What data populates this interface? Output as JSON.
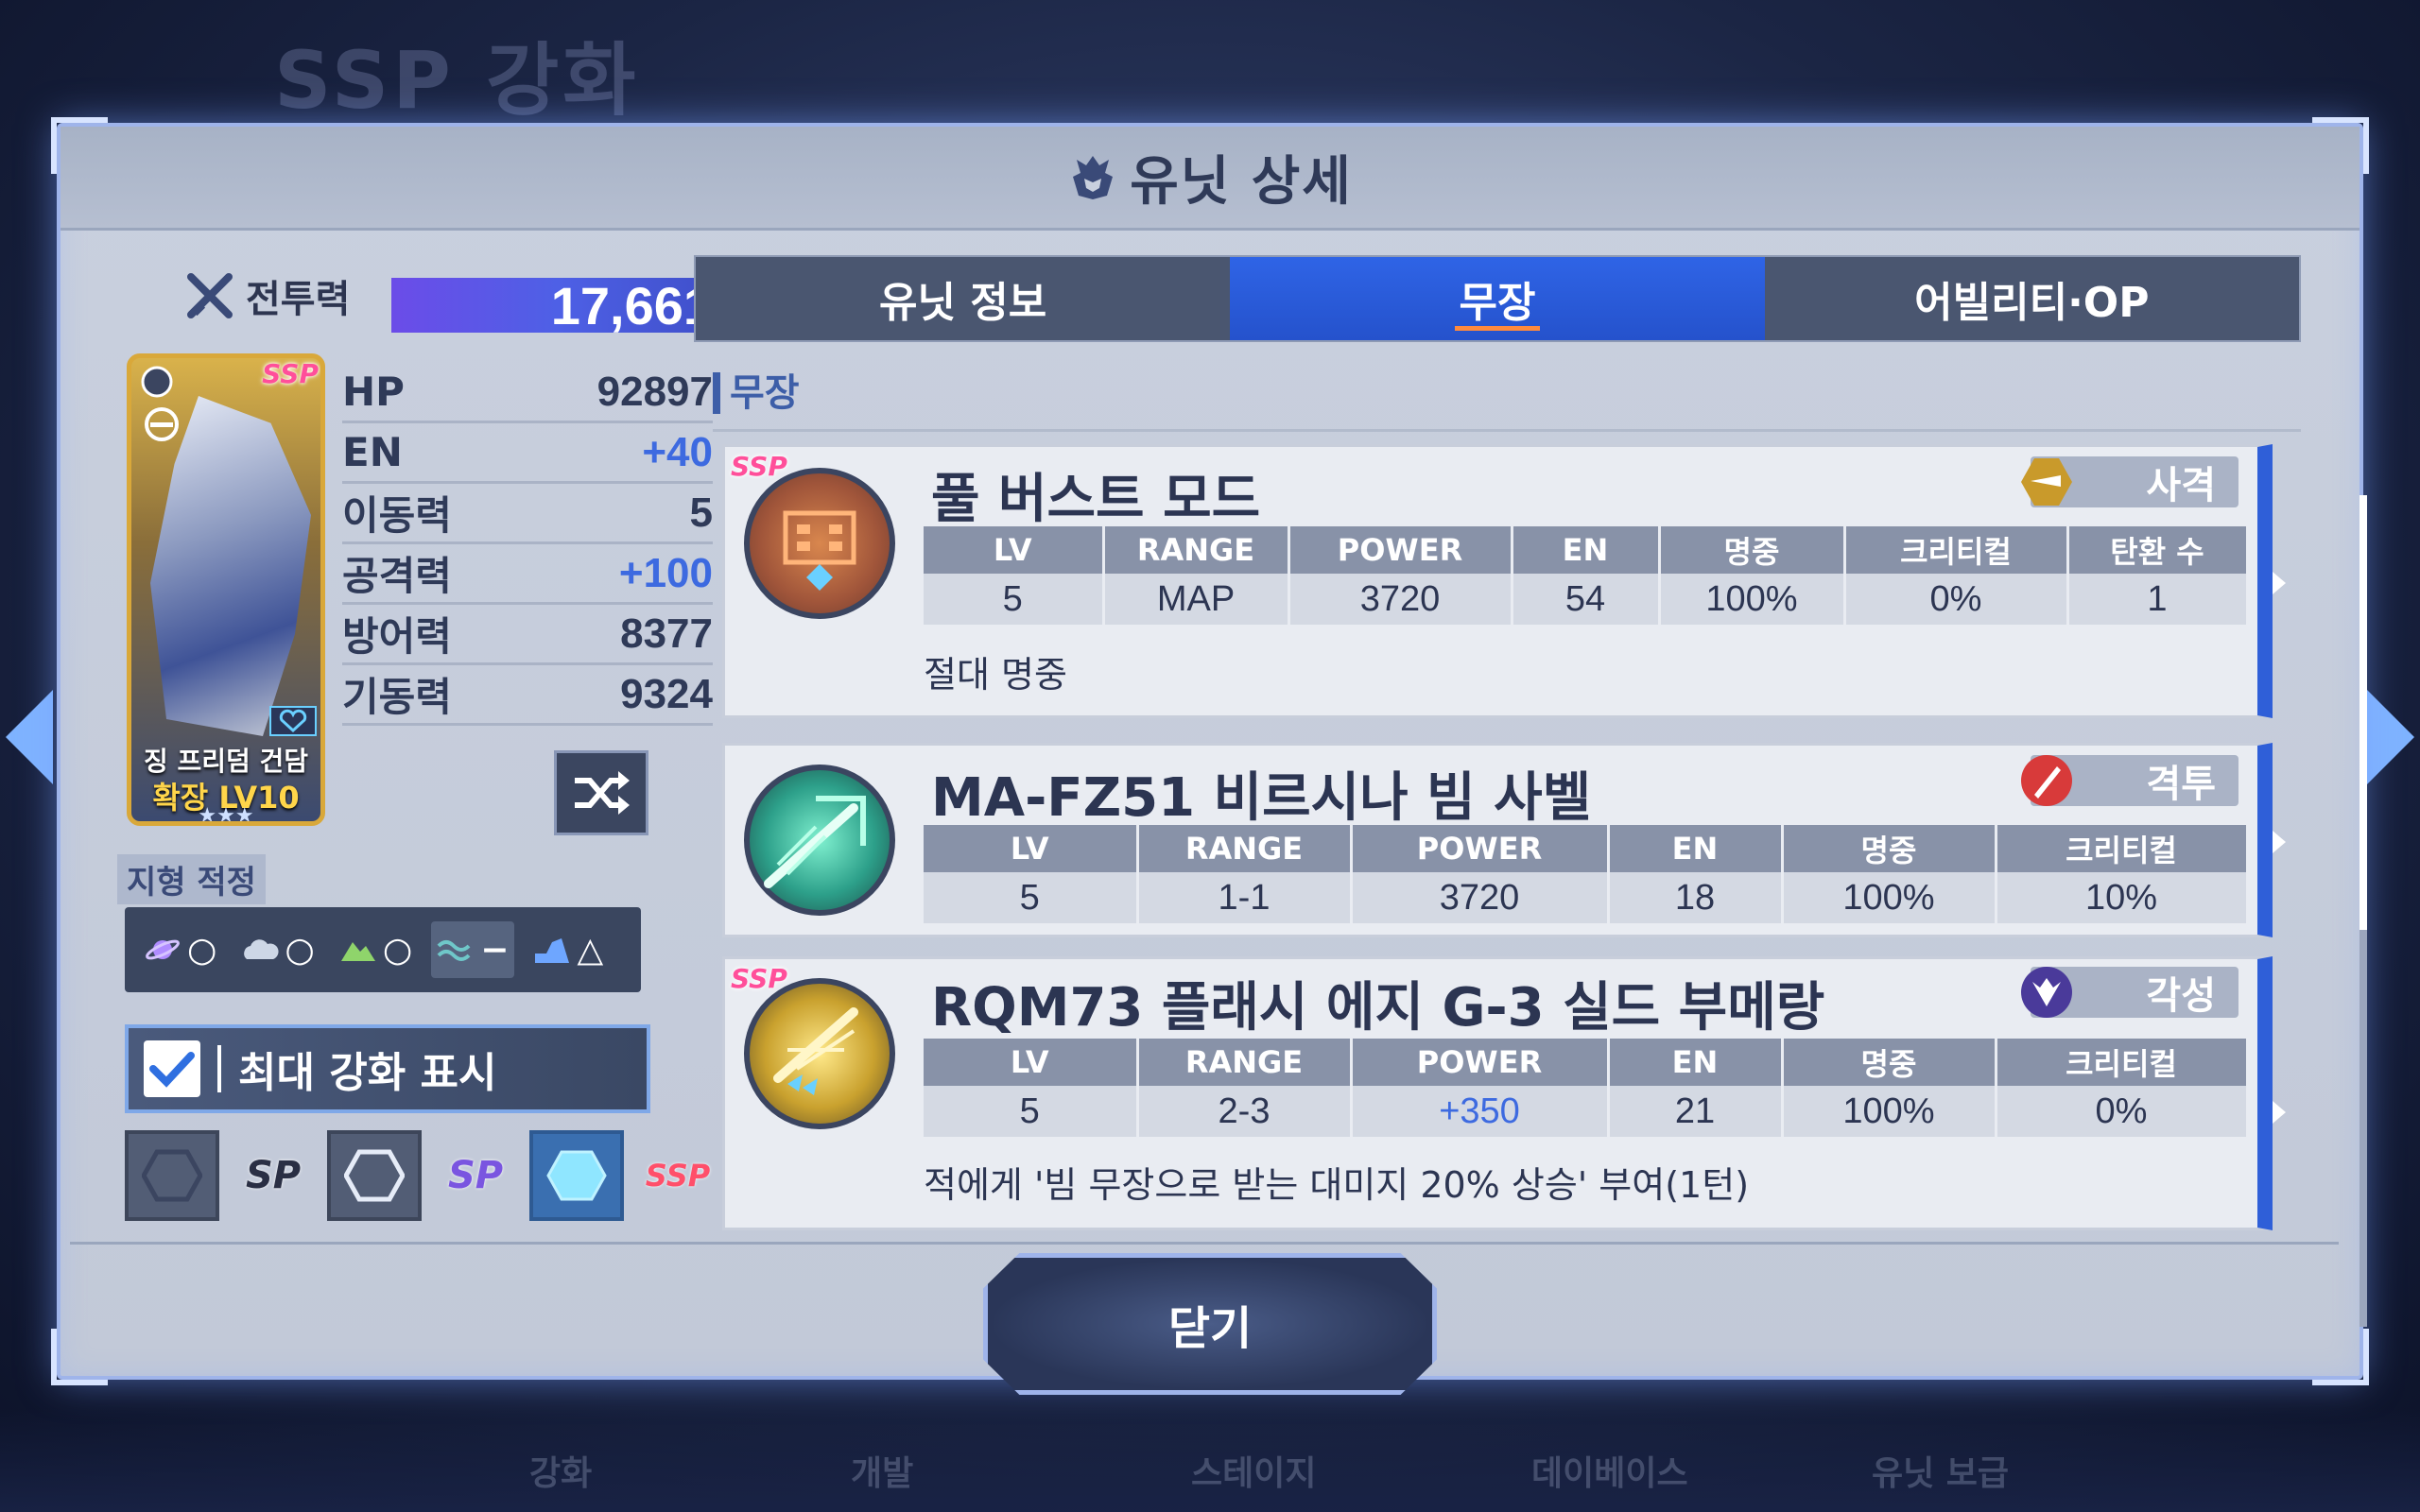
{
  "background": {
    "title": "SSP 강화",
    "nav": [
      "강화",
      "개발",
      "스테이지",
      "데이베이스",
      "유닛 보급"
    ]
  },
  "header": {
    "title": "유닛 상세"
  },
  "unit": {
    "power_label": "전투력",
    "power_value": "17,661",
    "name": "징 프리덤 건담",
    "level": "확장 LV10",
    "stars": "★★★",
    "rarity": "SSP",
    "stats": [
      {
        "label": "HP",
        "value": "92897",
        "highlight": false
      },
      {
        "label": "EN",
        "value": "+40",
        "highlight": true
      },
      {
        "label": "이동력",
        "value": "5",
        "highlight": false
      },
      {
        "label": "공격력",
        "value": "+100",
        "highlight": true
      },
      {
        "label": "방어력",
        "value": "8377",
        "highlight": false
      },
      {
        "label": "기동력",
        "value": "9324",
        "highlight": false
      }
    ],
    "terrain_title": "지형 적정",
    "terrain": [
      {
        "icon": "space-icon",
        "grade": "○"
      },
      {
        "icon": "air-icon",
        "grade": "○"
      },
      {
        "icon": "ground-icon",
        "grade": "○"
      },
      {
        "icon": "water-icon",
        "grade": "−"
      },
      {
        "icon": "underground-icon",
        "grade": "△"
      }
    ],
    "max_upgrade_label": "최대 강화 표시",
    "grades": [
      {
        "logo": "SP",
        "active": false
      },
      {
        "logo": "SP",
        "active": false
      },
      {
        "logo": "SSP",
        "active": true
      }
    ]
  },
  "tabs": [
    {
      "label": "유닛 정보",
      "active": false
    },
    {
      "label": "무장",
      "active": true
    },
    {
      "label": "어빌리티·OP",
      "active": false
    }
  ],
  "section_title": "무장",
  "weapons": [
    {
      "name": "풀 버스트 모드",
      "type": "사격",
      "ssp": true,
      "headers": [
        "LV",
        "RANGE",
        "POWER",
        "EN",
        "명중",
        "크리티컬",
        "탄환 수"
      ],
      "values": [
        "5",
        "MAP",
        "3720",
        "54",
        "100%",
        "0%",
        "1"
      ],
      "desc": "절대 명중"
    },
    {
      "name": "MA-FZ51 비르시나 빔 사벨",
      "type": "격투",
      "ssp": false,
      "headers": [
        "LV",
        "RANGE",
        "POWER",
        "EN",
        "명중",
        "크리티컬"
      ],
      "values": [
        "5",
        "1-1",
        "3720",
        "18",
        "100%",
        "10%"
      ],
      "desc": ""
    },
    {
      "name": "RQM73 플래시 에지 G-3 실드 부메랑",
      "type": "각성",
      "ssp": true,
      "headers": [
        "LV",
        "RANGE",
        "POWER",
        "EN",
        "명중",
        "크리티컬"
      ],
      "values": [
        "5",
        "2-3",
        "+350",
        "21",
        "100%",
        "0%"
      ],
      "desc": "적에게 '빔 무장으로 받는 대미지 20% 상승' 부여(1턴)"
    }
  ],
  "close_label": "닫기"
}
